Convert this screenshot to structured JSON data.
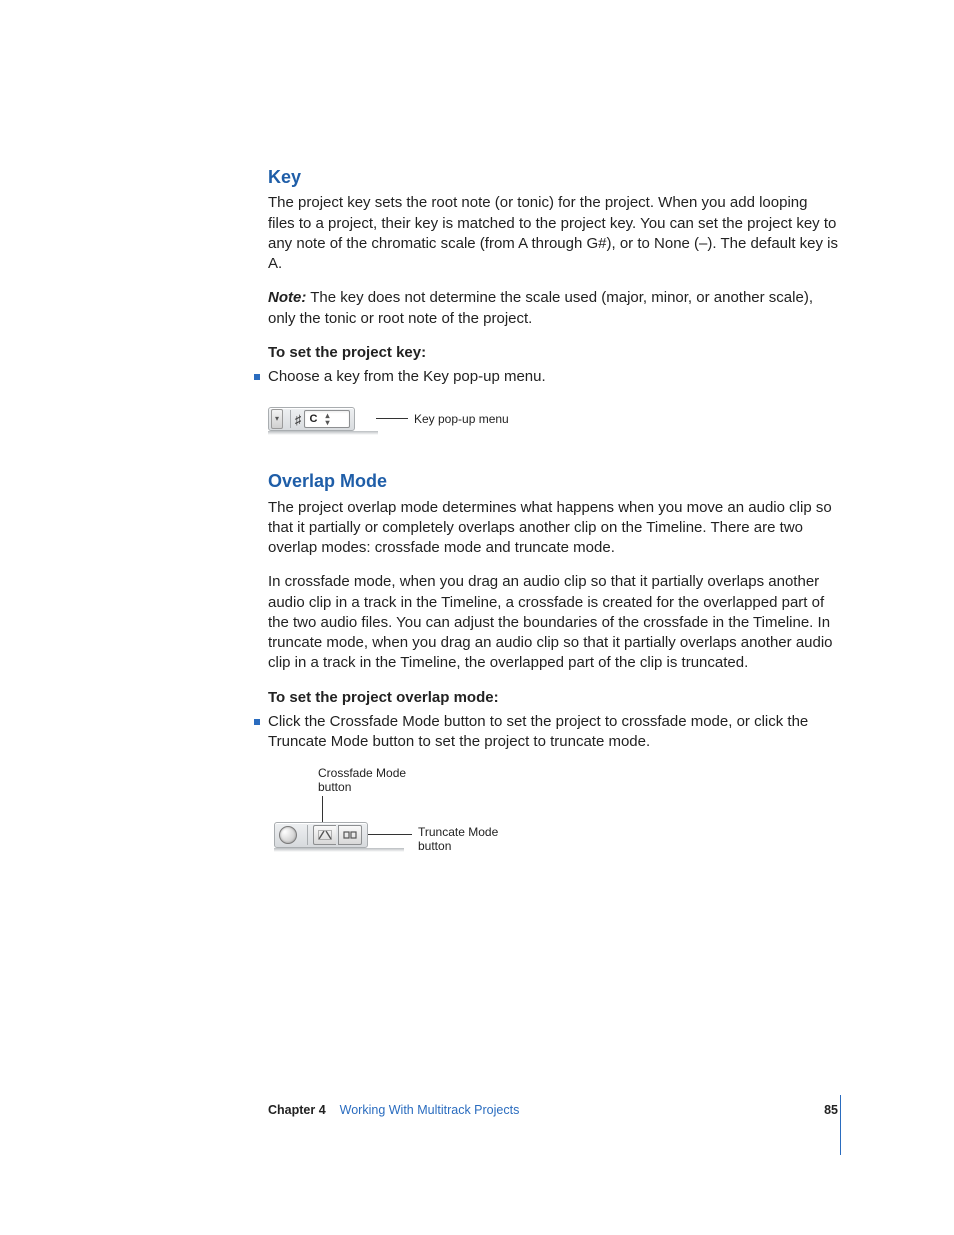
{
  "section_key": {
    "heading": "Key",
    "para1": "The project key sets the root note (or tonic) for the project. When you add looping files to a project, their key is matched to the project key. You can set the project key to any note of the chromatic scale (from A through G#), or to None (–). The default key is A.",
    "note_label": "Note:",
    "note_text": "  The key does not determine the scale used (major, minor, or another scale), only the tonic or root note of the project.",
    "instruction": "To set the project key:",
    "bullet1": "Choose a key from the Key pop-up menu.",
    "popup_value": "C",
    "callout": "Key pop-up menu"
  },
  "section_overlap": {
    "heading": "Overlap Mode",
    "para1": "The project overlap mode determines what happens when you move an audio clip so that it partially or completely overlaps another clip on the Timeline. There are two overlap modes:  crossfade mode and truncate mode.",
    "para2": "In crossfade mode, when you drag an audio clip so that it partially overlaps another audio clip in a track in the Timeline, a crossfade is created for the overlapped part of the two audio files. You can adjust the boundaries of the crossfade in the Timeline. In truncate mode, when you drag an audio clip so that it partially overlaps another audio clip in a track in the Timeline, the overlapped part of the clip is truncated.",
    "instruction": "To set the project overlap mode:",
    "bullet1": "Click the Crossfade Mode button to set the project to crossfade mode, or click the Truncate Mode button to set the project to truncate mode.",
    "callout_crossfade_l1": "Crossfade Mode",
    "callout_crossfade_l2": "button",
    "callout_truncate_l1": "Truncate Mode",
    "callout_truncate_l2": "button"
  },
  "footer": {
    "chapter": "Chapter 4",
    "title": "Working With Multitrack Projects",
    "page": "85"
  }
}
